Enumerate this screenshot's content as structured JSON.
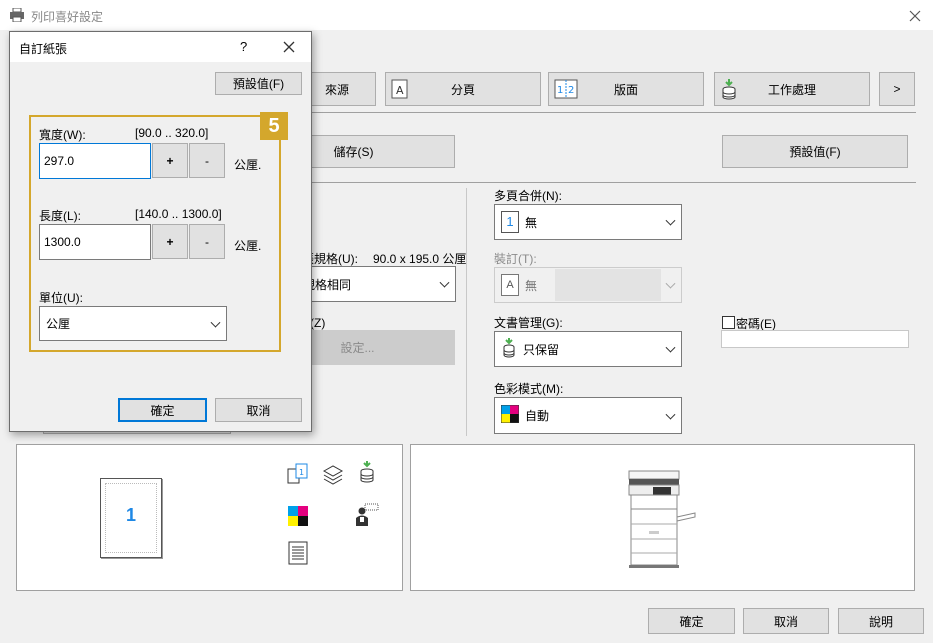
{
  "window": {
    "title": "列印喜好設定"
  },
  "tabs": [
    {
      "label": "來源"
    },
    {
      "label": "分頁"
    },
    {
      "label": "版面"
    },
    {
      "label": "工作處理"
    },
    {
      "label": ">"
    }
  ],
  "toolbar": {
    "save_label": "儲存(S)",
    "default_label": "預設值(F)"
  },
  "left_form": {
    "paper_size_label": "紙張規格(U):",
    "paper_size_value": "90.0 x 195.0 公厘",
    "paper_select_value": "與紙張規格相同",
    "zoom_label": "(Z)",
    "settings_button": "設定..."
  },
  "right_form": {
    "multipage_label": "多頁合併(N):",
    "multipage_value": "無",
    "binding_label": "裝訂(T):",
    "binding_value": "無",
    "doc_label": "文書管理(G):",
    "doc_value": "只保留",
    "color_label": "色彩模式(M):",
    "color_value": "自動",
    "password_label": "密碼(E)",
    "password_value": ""
  },
  "preview": {
    "page_number": "1"
  },
  "footer": {
    "ok": "確定",
    "cancel": "取消",
    "help": "說明"
  },
  "dialog": {
    "title": "自訂紙張",
    "help_icon": "?",
    "default_button": "預設值(F)",
    "badge": "5",
    "width_label": "寬度(W):",
    "width_range": "[90.0 .. 320.0]",
    "width_value": "297.0",
    "length_label": "長度(L):",
    "length_range": "[140.0 .. 1300.0]",
    "length_value": "1300.0",
    "plus": "+",
    "minus": "-",
    "unit_text": "公厘.",
    "unit_label": "單位(U):",
    "unit_value": "公厘",
    "ok": "確定",
    "cancel": "取消",
    "colors": {
      "highlight": "#d4a72c",
      "focus": "#0078d7"
    }
  }
}
